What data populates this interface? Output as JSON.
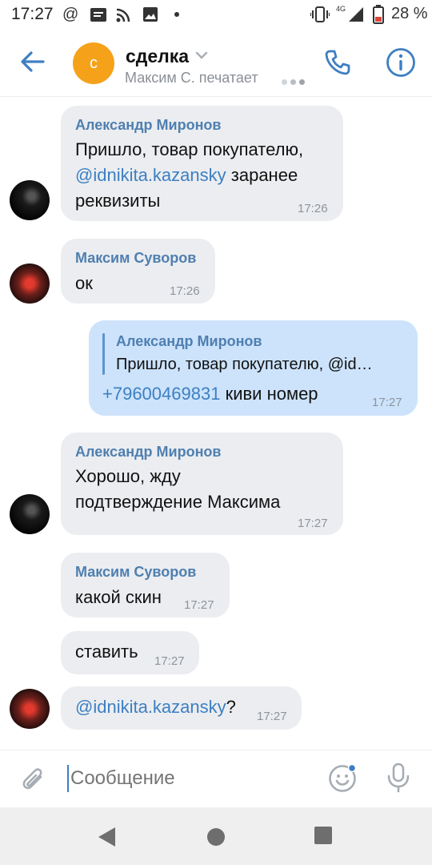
{
  "status_bar": {
    "time": "17:27",
    "icons": [
      "at-icon",
      "message-icon",
      "rss-icon",
      "image-icon",
      "dot-icon",
      "vibrate-icon",
      "4g-icon",
      "signal-icon",
      "battery-icon"
    ],
    "battery_percent": "28 %"
  },
  "header": {
    "avatar_letter": "с",
    "title": "сделка",
    "subtitle": "Максим С. печатает",
    "accent_color": "#3d7fc2",
    "avatar_color": "#f5a21a"
  },
  "messages": [
    {
      "sender": "Александр Миронов",
      "text_before": "Пришло, товар покупателю,",
      "mention": "@idnikita.kazansky",
      "text_after": "заранее",
      "text_line3": "реквизиты",
      "time": "17:26"
    },
    {
      "sender": "Максим Суворов",
      "text": "ок",
      "time": "17:26"
    },
    {
      "reply_to": "Александр Миронов",
      "reply_text": "Пришло, товар покупателю, @id…",
      "phone": "+79600469831",
      "text_after": "киви номер",
      "time": "17:27"
    },
    {
      "sender": "Александр Миронов",
      "line1": "Хорошо, жду",
      "line2": "подтверждение Максима",
      "time": "17:27"
    },
    {
      "sender": "Максим Суворов",
      "text": "какой скин",
      "time": "17:27"
    },
    {
      "text": "ставить",
      "time": "17:27"
    },
    {
      "mention": "@idnikita.kazansky",
      "text_after": "?",
      "time": "17:27"
    }
  ],
  "composer": {
    "placeholder": "Сообщение"
  }
}
